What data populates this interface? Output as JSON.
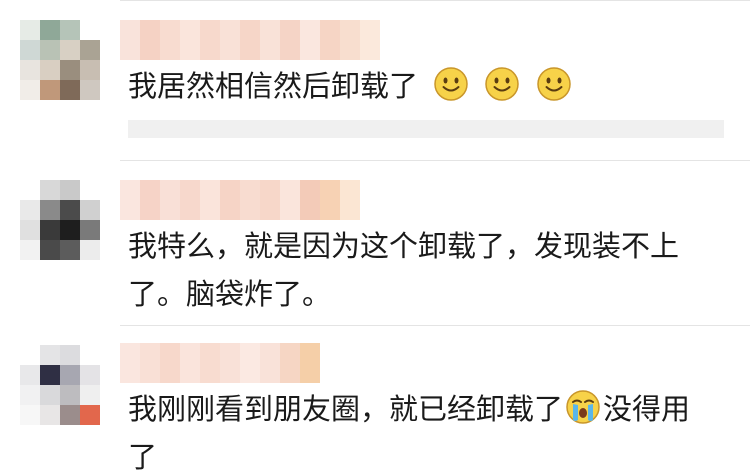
{
  "comments": [
    {
      "text": "我居然相信然后卸载了",
      "emojis": [
        "smile-emoji",
        "smile-emoji",
        "smile-emoji"
      ]
    },
    {
      "text_line1": "我特么，就是因为这个卸载了，发现装不上",
      "text_line2": "了。脑袋炸了。"
    },
    {
      "text_before": "我刚刚看到朋友圈，就已经卸载了",
      "emoji": "crying-emoji",
      "text_after": "没得用",
      "text_line2": "了"
    }
  ]
}
